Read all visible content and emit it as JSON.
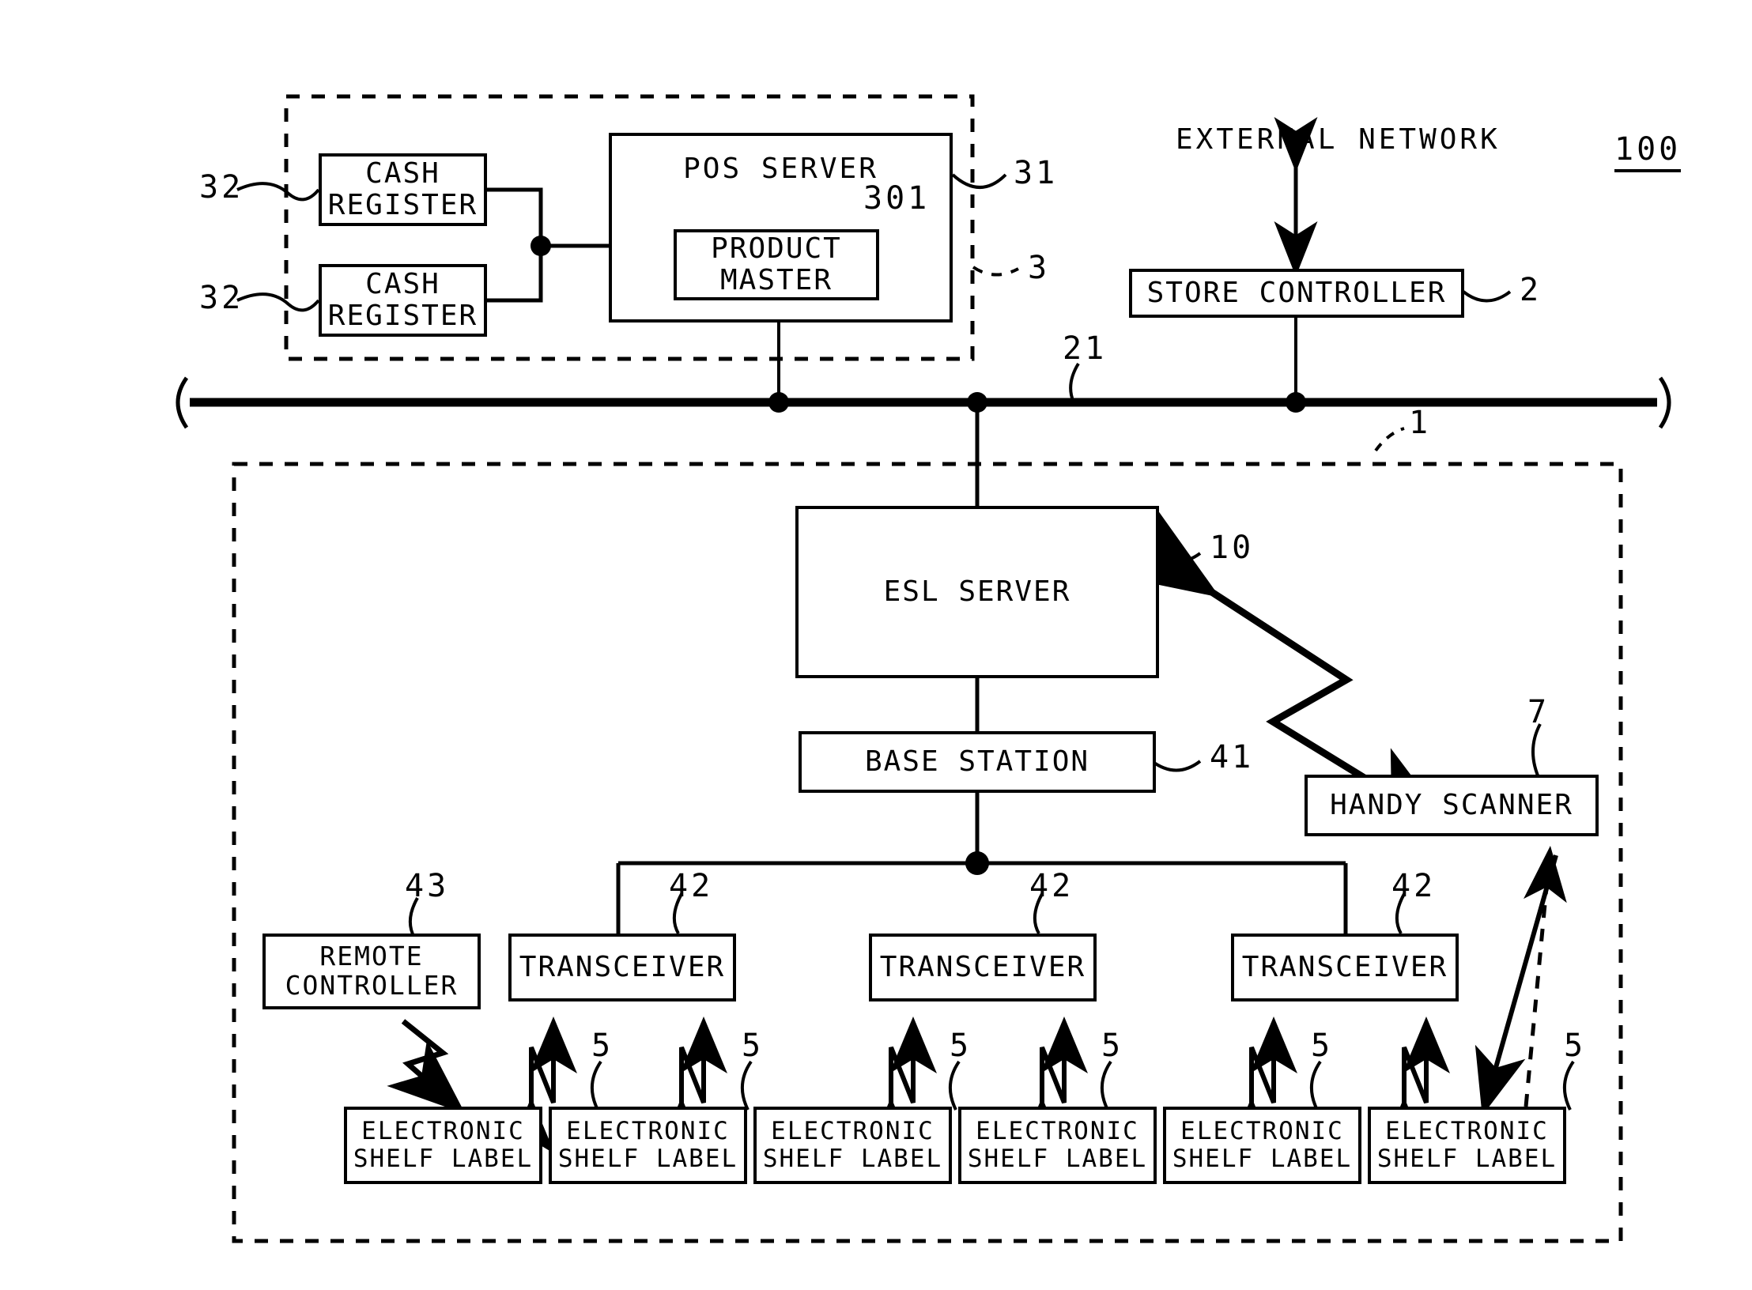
{
  "figure": {
    "system_ref": "100",
    "external_network_label": "EXTERNAL NETWORK"
  },
  "pos_group": {
    "ref": "3",
    "cash_register_1": {
      "line1": "CASH",
      "line2": "REGISTER",
      "ref": "32"
    },
    "cash_register_2": {
      "line1": "CASH",
      "line2": "REGISTER",
      "ref": "32"
    },
    "pos_server": {
      "label": "POS SERVER",
      "ref": "31"
    },
    "product_master": {
      "line1": "PRODUCT",
      "line2": "MASTER",
      "ref": "301"
    }
  },
  "store_controller": {
    "label": "STORE CONTROLLER",
    "ref": "2"
  },
  "network_bus": {
    "ref": "21"
  },
  "esl_group": {
    "ref": "1",
    "esl_server": {
      "label": "ESL SERVER",
      "ref": "10"
    },
    "base_station": {
      "label": "BASE STATION",
      "ref": "41"
    },
    "handy_scanner": {
      "label": "HANDY SCANNER",
      "ref": "7"
    },
    "remote_controller": {
      "line1": "REMOTE",
      "line2": "CONTROLLER",
      "ref": "43"
    },
    "transceivers": [
      {
        "label": "TRANSCEIVER",
        "ref": "42"
      },
      {
        "label": "TRANSCEIVER",
        "ref": "42"
      },
      {
        "label": "TRANSCEIVER",
        "ref": "42"
      }
    ],
    "shelf_labels": [
      {
        "line1": "ELECTRONIC",
        "line2": "SHELF LABEL",
        "ref": "5"
      },
      {
        "line1": "ELECTRONIC",
        "line2": "SHELF LABEL",
        "ref": "5"
      },
      {
        "line1": "ELECTRONIC",
        "line2": "SHELF LABEL",
        "ref": "5"
      },
      {
        "line1": "ELECTRONIC",
        "line2": "SHELF LABEL",
        "ref": "5"
      },
      {
        "line1": "ELECTRONIC",
        "line2": "SHELF LABEL",
        "ref": "5"
      },
      {
        "line1": "ELECTRONIC",
        "line2": "SHELF LABEL",
        "ref": "5"
      }
    ]
  },
  "colors": {
    "ink": "#000000",
    "paper": "#ffffff"
  }
}
